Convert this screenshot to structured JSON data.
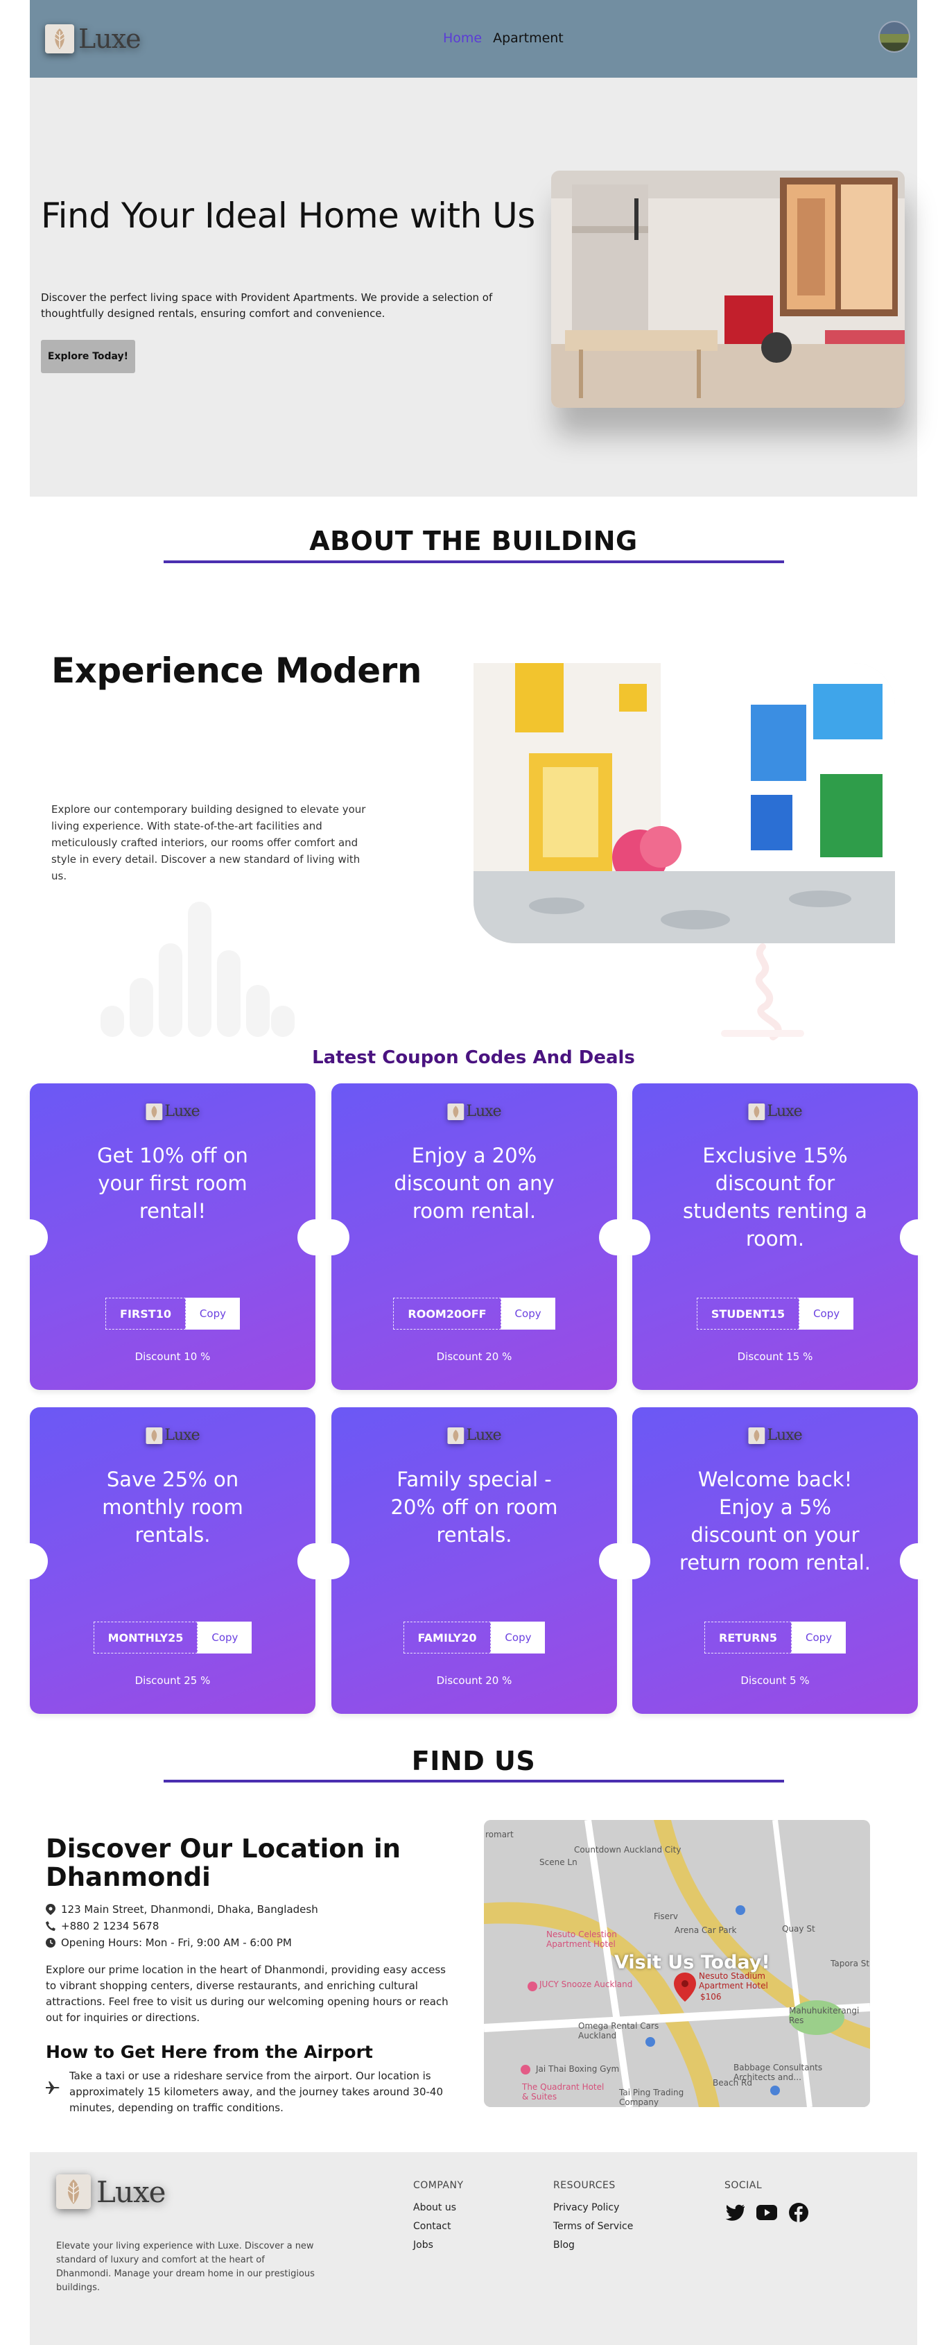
{
  "header": {
    "logo_text": "Luxe",
    "nav": [
      {
        "label": "Home",
        "active": true
      },
      {
        "label": "Apartment",
        "active": false
      }
    ]
  },
  "hero": {
    "title": "Find Your Ideal Home with Us",
    "description": "Discover the perfect living space with Provident Apartments. We provide a selection of thoughtfully designed rentals, ensuring comfort and convenience.",
    "button_label": "Explore Today!"
  },
  "about": {
    "heading": "ABOUT THE BUILDING",
    "title": "Experience Modern",
    "description": "Explore our contemporary building designed to elevate your living experience. With state-of-the-art facilities and meticulously crafted interiors, our rooms offer comfort and style in every detail. Discover a new standard of living with us."
  },
  "coupons": {
    "title": "Latest Coupon Codes And Deals",
    "copy_label": "Copy",
    "items": [
      {
        "text": "Get 10% off on your first room rental!",
        "code": "FIRST10",
        "discount": "Discount 10 %"
      },
      {
        "text": "Enjoy a 20% discount on any room rental.",
        "code": "ROOM20OFF",
        "discount": "Discount 20 %"
      },
      {
        "text": "Exclusive 15% discount for students renting a room.",
        "code": "STUDENT15",
        "discount": "Discount 15 %"
      },
      {
        "text": "Save 25% on monthly room rentals.",
        "code": "MONTHLY25",
        "discount": "Discount 25 %"
      },
      {
        "text": "Family special - 20% off on room rentals.",
        "code": "FAMILY20",
        "discount": "Discount 20 %"
      },
      {
        "text": "Welcome back! Enjoy a 5% discount on your return room rental.",
        "code": "RETURN5",
        "discount": "Discount 5 %"
      }
    ]
  },
  "find_us": {
    "heading": "FIND US",
    "title": "Discover Our Location in Dhanmondi",
    "address": "123 Main Street, Dhanmondi, Dhaka, Bangladesh",
    "phone": "+880 2 1234 5678",
    "hours": "Opening Hours: Mon - Fri, 9:00 AM - 6:00 PM",
    "description": "Explore our prime location in the heart of Dhanmondi, providing easy access to vibrant shopping centers, diverse restaurants, and enriching cultural attractions. Feel free to visit us during our welcoming opening hours or reach out for inquiries or directions.",
    "airport_title": "How to Get Here from the Airport",
    "airport_text": "Take a taxi or use a rideshare service from the airport. Our location is approximately 15 kilometers away, and the journey takes around 30-40 minutes, depending on traffic conditions.",
    "map": {
      "overlay": "Visit Us Today!",
      "labels": [
        "Countdown Auckland City",
        "Fiserv",
        "Arena Car Park",
        "Quay St",
        "Nesuto Celestion Apartment Hotel",
        "Nesuto Stadium Apartment Hotel",
        "$106",
        "JUCY Snooze Auckland",
        "Omega Rental Cars Auckland",
        "Mahuhukiterangi Res",
        "Jai Thai Boxing Gym",
        "Babbage Consultants Architects and...",
        "The Quadrant Hotel & Suites",
        "Tai Ping Trading Company",
        "Beach Rd",
        "Scene Ln",
        "romart",
        "Tapora St"
      ]
    }
  },
  "footer": {
    "logo_text": "Luxe",
    "description": "Elevate your living experience with Luxe. Discover a new standard of luxury and comfort at the heart of Dhanmondi. Manage your dream home in our prestigious buildings.",
    "company": {
      "heading": "COMPANY",
      "links": [
        "About us",
        "Contact",
        "Jobs"
      ]
    },
    "resources": {
      "heading": "RESOURCES",
      "links": [
        "Privacy Policy",
        "Terms of Service",
        "Blog"
      ]
    },
    "social": {
      "heading": "SOCIAL",
      "icons": [
        "twitter-icon",
        "youtube-icon",
        "facebook-icon"
      ]
    }
  },
  "colors": {
    "header_bg": "#728ea1",
    "accent": "#5b3cd6",
    "section_line": "#4b2fb0",
    "coupon_gradient_start": "#6b58f5",
    "coupon_gradient_end": "#9b4be4",
    "coupon_title": "#4a1380",
    "panel_bg": "#ececec"
  }
}
